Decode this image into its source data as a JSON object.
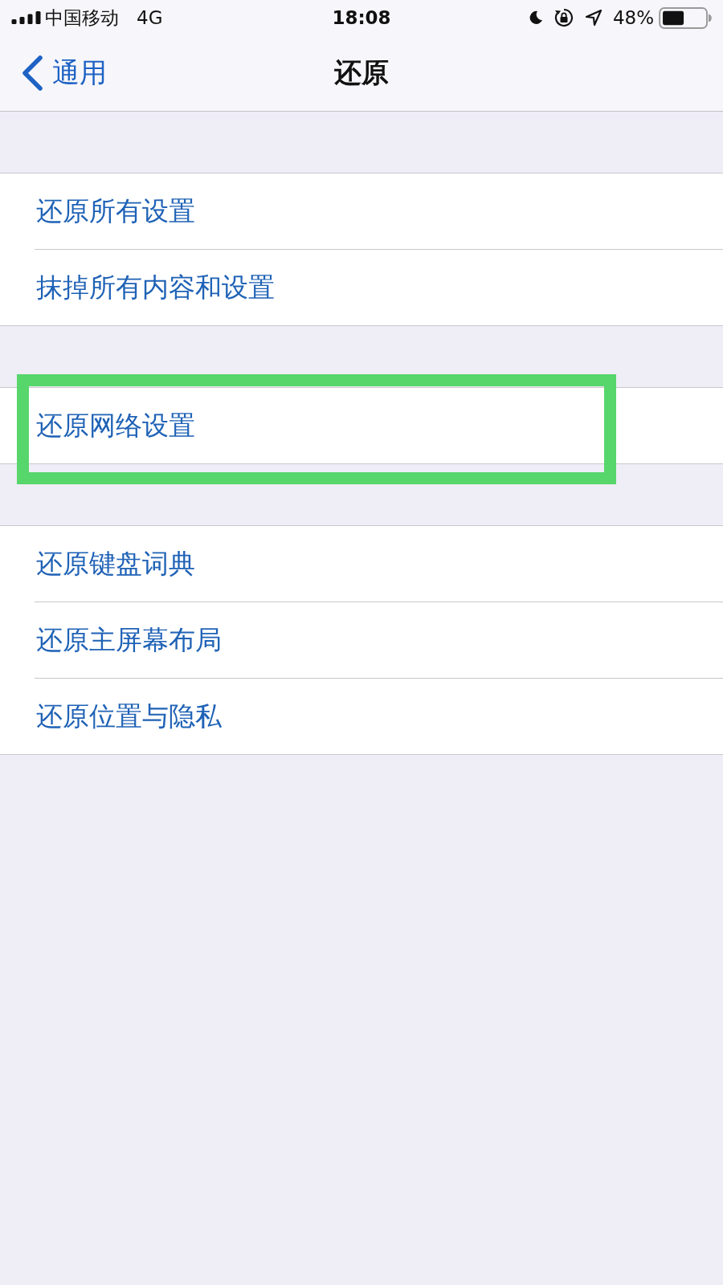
{
  "status_bar": {
    "carrier": "中国移动",
    "network": "4G",
    "time": "18:08",
    "battery_percent": "48%"
  },
  "nav_bar": {
    "back_label": "通用",
    "title": "还原"
  },
  "sections": [
    {
      "highlighted": false,
      "items": [
        {
          "label": "还原所有设置"
        },
        {
          "label": "抹掉所有内容和设置"
        }
      ]
    },
    {
      "highlighted": true,
      "items": [
        {
          "label": "还原网络设置"
        }
      ]
    },
    {
      "highlighted": false,
      "items": [
        {
          "label": "还原键盘词典"
        },
        {
          "label": "还原主屏幕布局"
        },
        {
          "label": "还原位置与隐私"
        }
      ]
    }
  ]
}
